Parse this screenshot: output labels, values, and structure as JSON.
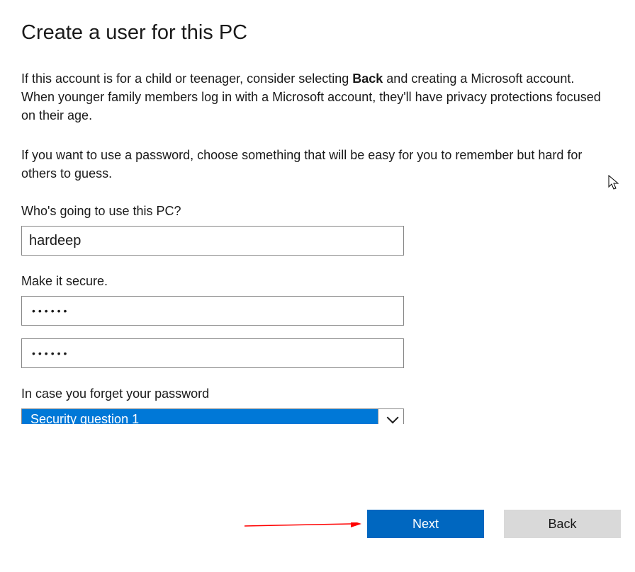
{
  "page_title": "Create a user for this PC",
  "paragraph1_pre": "If this account is for a child or teenager, consider selecting ",
  "paragraph1_bold": "Back",
  "paragraph1_post": " and creating a Microsoft account. When younger family members log in with a Microsoft account, they'll have privacy protections focused on their age.",
  "paragraph2": "If you want to use a password, choose something that will be easy for you to remember but hard for others to guess.",
  "section_username": {
    "label": "Who's going to use this PC?",
    "value": "hardeep"
  },
  "section_password": {
    "label": "Make it secure.",
    "password_value": "••••••",
    "confirm_value": "••••••"
  },
  "section_security": {
    "label": "In case you forget your password",
    "selected": "Security question 1"
  },
  "buttons": {
    "next": "Next",
    "back": "Back"
  },
  "colors": {
    "primary": "#0067c0",
    "select_highlight": "#0078d7",
    "secondary_btn": "#d9d9d9",
    "border": "#888888",
    "arrow": "#ff0000"
  }
}
